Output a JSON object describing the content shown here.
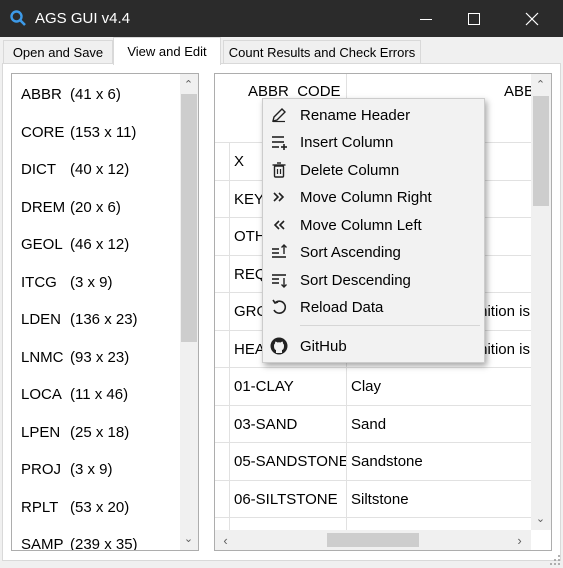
{
  "window": {
    "title": "AGS GUI v4.4"
  },
  "tabs": [
    {
      "label": "Open and Save",
      "active": false
    },
    {
      "label": "View and Edit",
      "active": true
    },
    {
      "label": "Count Results and Check Errors",
      "active": false
    }
  ],
  "groups": [
    {
      "name": "ABBR",
      "dims": "(41 x 6)"
    },
    {
      "name": "CORE",
      "dims": "(153 x 11)"
    },
    {
      "name": "DICT",
      "dims": "(40 x 12)"
    },
    {
      "name": "DREM",
      "dims": "(20 x 6)"
    },
    {
      "name": "GEOL",
      "dims": "(46 x 12)"
    },
    {
      "name": "ITCG",
      "dims": "(3 x 9)"
    },
    {
      "name": "LDEN",
      "dims": "(136 x 23)"
    },
    {
      "name": "LNMC",
      "dims": "(93 x 23)"
    },
    {
      "name": "LOCA",
      "dims": "(11 x 46)"
    },
    {
      "name": "LPEN",
      "dims": "(25 x 18)"
    },
    {
      "name": "PROJ",
      "dims": "(3 x 9)"
    },
    {
      "name": "RPLT",
      "dims": "(53 x 20)"
    },
    {
      "name": "SAMP",
      "dims": "(239 x 35)"
    }
  ],
  "table": {
    "headers": [
      "ABBR_CODE",
      "ABB"
    ],
    "rows": [
      [
        "X",
        ""
      ],
      [
        "KEY",
        ""
      ],
      [
        "OTH",
        ""
      ],
      [
        "REQ",
        ""
      ],
      [
        "GRO",
        "inition is"
      ],
      [
        "HEA",
        "inition is"
      ],
      [
        "01-CLAY",
        "Clay"
      ],
      [
        "03-SAND",
        "Sand"
      ],
      [
        "05-SANDSTONE",
        "Sandstone"
      ],
      [
        "06-SILTSTONE",
        "Siltstone"
      ]
    ]
  },
  "context_menu": {
    "items": [
      {
        "label": "Rename Header",
        "icon": "pencil-icon"
      },
      {
        "label": "Insert Column",
        "icon": "insert-column-icon"
      },
      {
        "label": "Delete Column",
        "icon": "trash-icon"
      },
      {
        "label": "Move Column Right",
        "icon": "double-chevron-right-icon"
      },
      {
        "label": "Move Column Left",
        "icon": "double-chevron-left-icon"
      },
      {
        "label": "Sort Ascending",
        "icon": "sort-ascending-icon"
      },
      {
        "label": "Sort Descending",
        "icon": "sort-descending-icon"
      },
      {
        "label": "Reload Data",
        "icon": "reload-icon"
      }
    ],
    "footer_item": {
      "label": "GitHub",
      "icon": "github-icon"
    }
  },
  "colors": {
    "titlebar": "#2b2b2b",
    "accent": "#3d9ae8"
  }
}
